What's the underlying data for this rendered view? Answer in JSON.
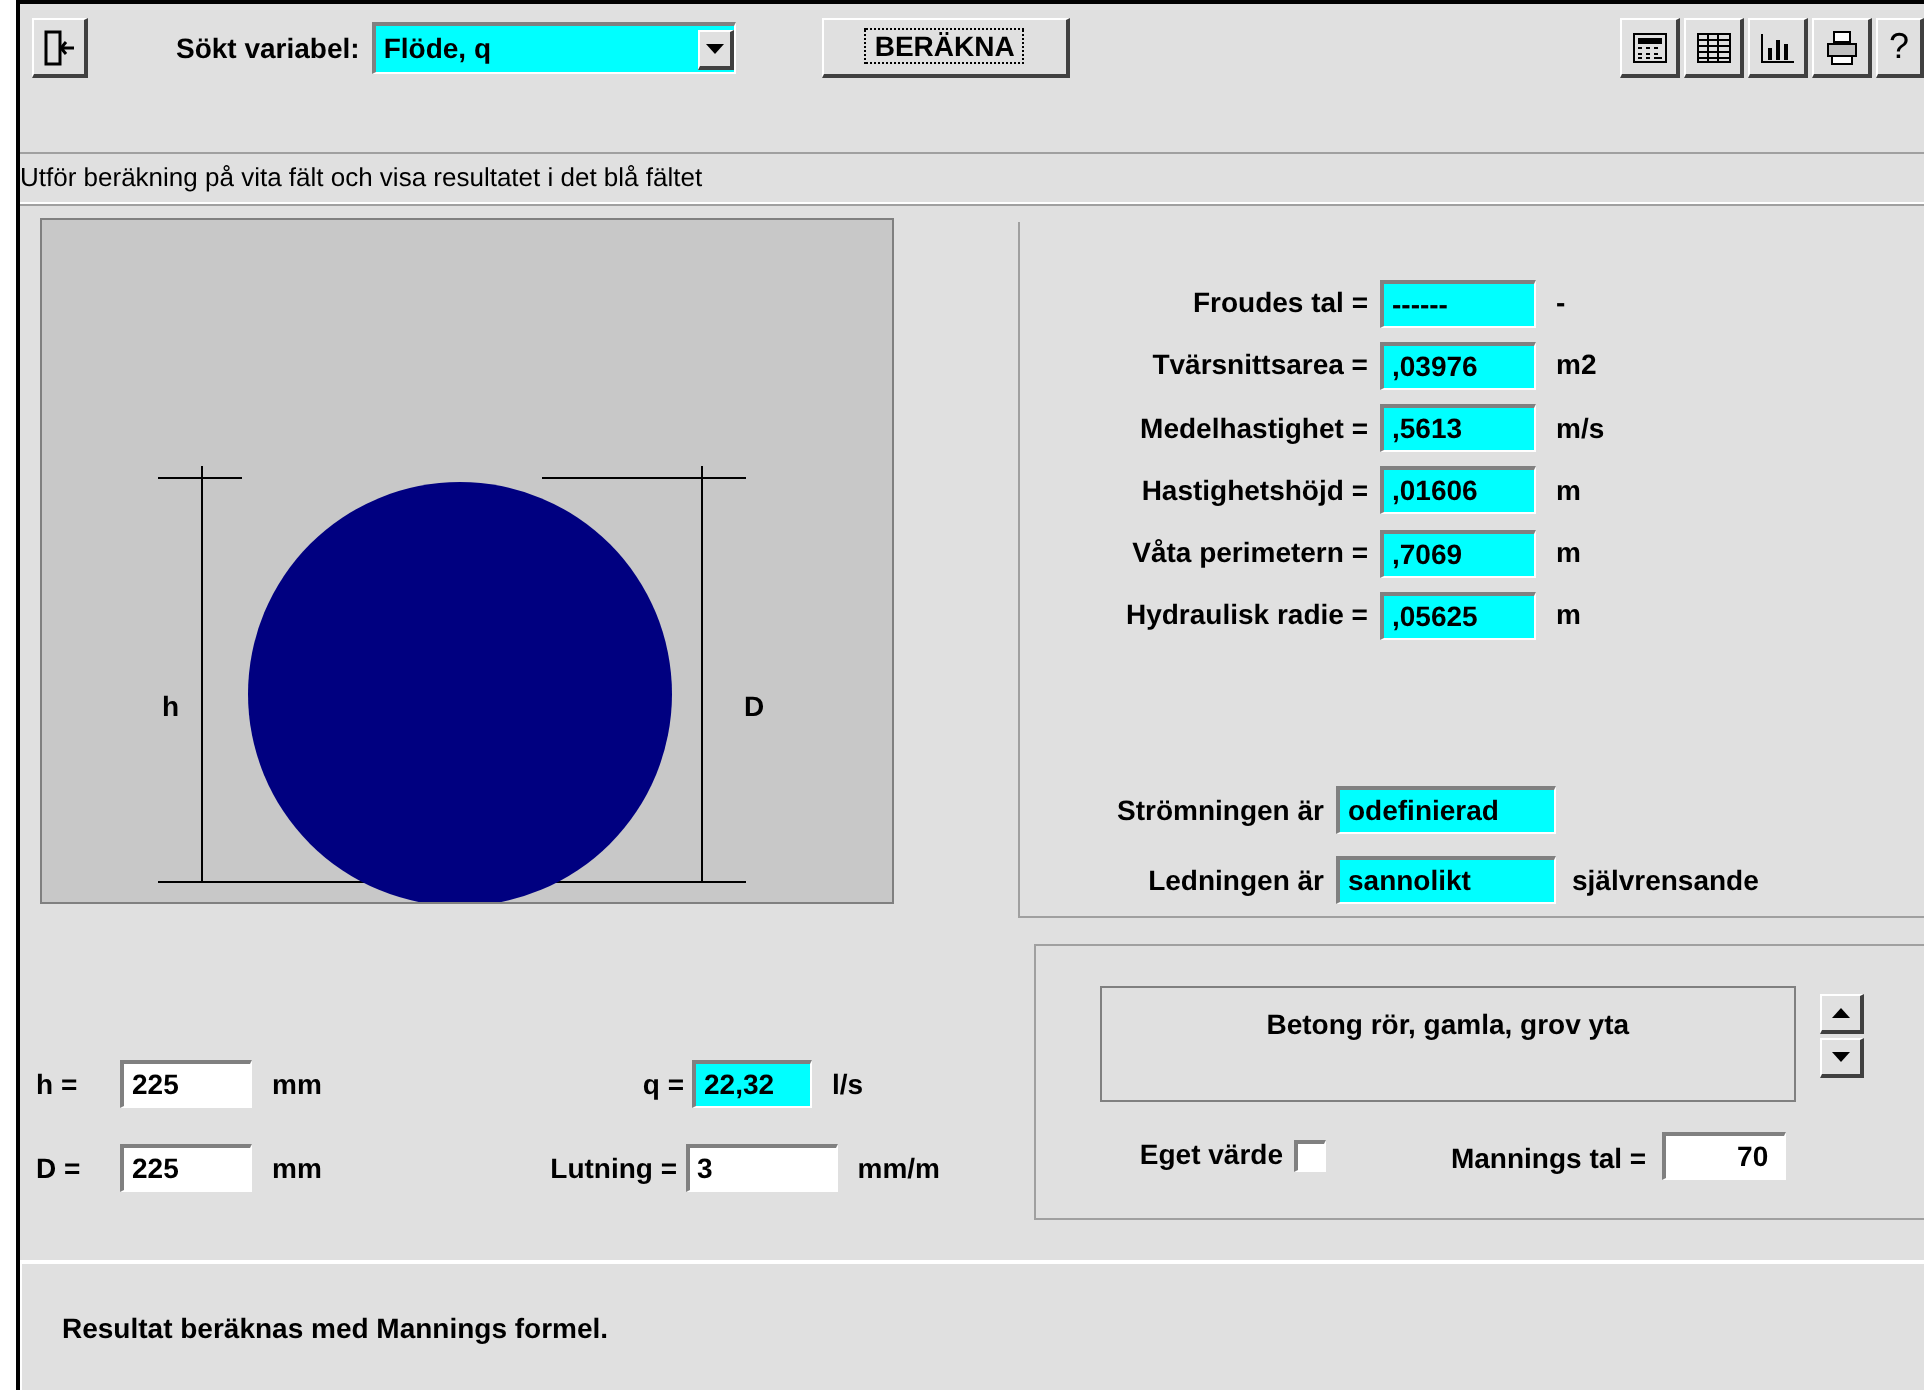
{
  "toolbar": {
    "variable_label": "Sökt variabel:",
    "variable_value": "Flöde, q",
    "calculate_button": "BERÄKNA",
    "help_button": "?"
  },
  "hint": "Utför beräkning på vita fält och visa resultatet i det blå fältet",
  "diagram": {
    "height_label": "h",
    "diameter_label": "D"
  },
  "results": [
    {
      "label": "Froudes tal =",
      "value": "------",
      "unit": "-"
    },
    {
      "label": "Tvärsnittsarea =",
      "value": ",03976",
      "unit": "m2"
    },
    {
      "label": "Medelhastighet =",
      "value": ",5613",
      "unit": "m/s"
    },
    {
      "label": "Hastighetshöjd =",
      "value": ",01606",
      "unit": "m"
    },
    {
      "label": "Våta perimetern =",
      "value": ",7069",
      "unit": "m"
    },
    {
      "label": "Hydraulisk radie =",
      "value": ",05625",
      "unit": "m"
    }
  ],
  "flow": {
    "label": "Strömningen är",
    "value": "odefinierad"
  },
  "pipe": {
    "label": "Ledningen är",
    "value": "sannolikt",
    "suffix": "självrensande"
  },
  "inputs": [
    {
      "label": "h  =",
      "value": "225",
      "unit": "mm",
      "computed": false
    },
    {
      "label": "q =",
      "value": "22,32",
      "unit": "l/s",
      "computed": true
    },
    {
      "label": "D =",
      "value": "225",
      "unit": "mm",
      "computed": false
    },
    {
      "label": "Lutning =",
      "value": "3",
      "unit": "mm/m",
      "computed": false
    }
  ],
  "material": {
    "text": "Betong rör, gamla, grov yta",
    "own_value_label": "Eget värde",
    "own_value_checked": false,
    "manning_label": "Mannings tal =",
    "manning_value": "70"
  },
  "status": "Resultat beräknas med Mannings formel."
}
